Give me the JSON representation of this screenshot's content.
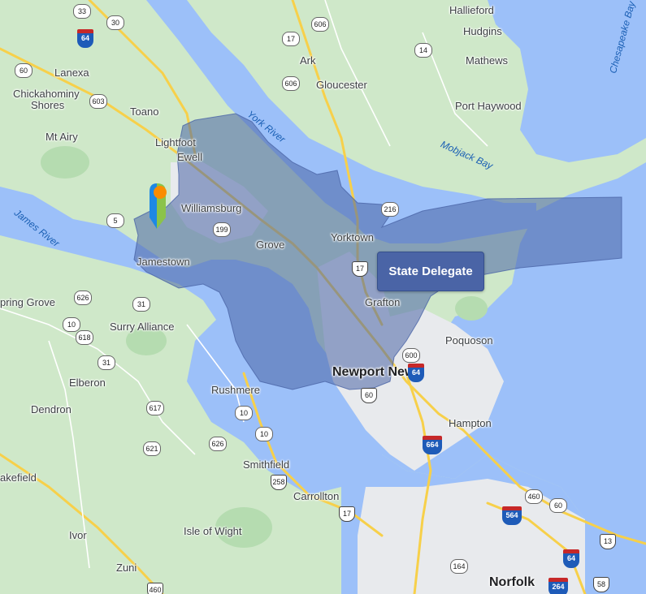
{
  "tooltip": {
    "label": "State Delegate"
  },
  "district_color": "#4a64a6",
  "pin_colors": [
    "#1e88e5",
    "#8bc34a",
    "#fb8c00"
  ],
  "water_labels": [
    {
      "name": "york-river",
      "text": "York River"
    },
    {
      "name": "james-river",
      "text": "James River"
    },
    {
      "name": "mobjack-bay",
      "text": "Mobjack Bay"
    },
    {
      "name": "chesapeake-bay",
      "text": "Chesapeake Bay"
    }
  ],
  "places": [
    {
      "name": "hallieford",
      "text": "Hallieford"
    },
    {
      "name": "hudgins",
      "text": "Hudgins"
    },
    {
      "name": "mathews",
      "text": "Mathews"
    },
    {
      "name": "ark",
      "text": "Ark"
    },
    {
      "name": "gloucester",
      "text": "Gloucester"
    },
    {
      "name": "port-haywood",
      "text": "Port Haywood"
    },
    {
      "name": "lanexa",
      "text": "Lanexa"
    },
    {
      "name": "chickahominy",
      "text": "Chickahominy"
    },
    {
      "name": "shores",
      "text": "Shores"
    },
    {
      "name": "toano",
      "text": "Toano"
    },
    {
      "name": "mt-airy",
      "text": "Mt Airy"
    },
    {
      "name": "lightfoot",
      "text": "Lightfoot"
    },
    {
      "name": "ewell",
      "text": "Ewell"
    },
    {
      "name": "williamsburg",
      "text": "Williamsburg"
    },
    {
      "name": "grove",
      "text": "Grove"
    },
    {
      "name": "yorktown",
      "text": "Yorktown"
    },
    {
      "name": "jamestown",
      "text": "Jamestown"
    },
    {
      "name": "spring-grove",
      "text": "pring Grove"
    },
    {
      "name": "surry-alliance",
      "text": "Surry Alliance"
    },
    {
      "name": "grafton",
      "text": "Grafton"
    },
    {
      "name": "poquoson",
      "text": "Poquoson"
    },
    {
      "name": "elberon",
      "text": "Elberon"
    },
    {
      "name": "newport-news",
      "text": "Newport News"
    },
    {
      "name": "dendron",
      "text": "Dendron"
    },
    {
      "name": "rushmere",
      "text": "Rushmere"
    },
    {
      "name": "hampton",
      "text": "Hampton"
    },
    {
      "name": "wakefield",
      "text": "akefield"
    },
    {
      "name": "smithfield",
      "text": "Smithfield"
    },
    {
      "name": "carrollton",
      "text": "Carrollton"
    },
    {
      "name": "ivor",
      "text": "Ivor"
    },
    {
      "name": "isle-of-wight",
      "text": "Isle of Wight"
    },
    {
      "name": "zuni",
      "text": "Zuni"
    },
    {
      "name": "norfolk",
      "text": "Norfolk"
    }
  ],
  "route_shields": [
    {
      "name": "route-33",
      "text": "33"
    },
    {
      "name": "route-30",
      "text": "30"
    },
    {
      "name": "route-606-n",
      "text": "606"
    },
    {
      "name": "route-17-n",
      "text": "17"
    },
    {
      "name": "route-14",
      "text": "14"
    },
    {
      "name": "route-606",
      "text": "606"
    },
    {
      "name": "route-60-w",
      "text": "60"
    },
    {
      "name": "route-603",
      "text": "603"
    },
    {
      "name": "route-5",
      "text": "5"
    },
    {
      "name": "route-216",
      "text": "216"
    },
    {
      "name": "route-199",
      "text": "199"
    },
    {
      "name": "route-626",
      "text": "626"
    },
    {
      "name": "route-31",
      "text": "31"
    },
    {
      "name": "route-10",
      "text": "10"
    },
    {
      "name": "route-618",
      "text": "618"
    },
    {
      "name": "route-31-s",
      "text": "31"
    },
    {
      "name": "route-600",
      "text": "600"
    },
    {
      "name": "route-60-s",
      "text": "60"
    },
    {
      "name": "route-617",
      "text": "617"
    },
    {
      "name": "route-10-s",
      "text": "10"
    },
    {
      "name": "route-10-e",
      "text": "10"
    },
    {
      "name": "route-621",
      "text": "621"
    },
    {
      "name": "route-626-s",
      "text": "626"
    },
    {
      "name": "route-258",
      "text": "258"
    },
    {
      "name": "route-17-s",
      "text": "17"
    },
    {
      "name": "route-460",
      "text": "460"
    },
    {
      "name": "route-60-e",
      "text": "60"
    },
    {
      "name": "route-13",
      "text": "13"
    },
    {
      "name": "route-164",
      "text": "164"
    },
    {
      "name": "route-58",
      "text": "58"
    },
    {
      "name": "route-460-s",
      "text": "460"
    }
  ],
  "us_shields": [
    {
      "name": "us-17-n",
      "text": "17"
    },
    {
      "name": "us-17-mid",
      "text": "17"
    },
    {
      "name": "us-60-w",
      "text": "60"
    },
    {
      "name": "us-60-nn",
      "text": "60"
    },
    {
      "name": "us-17-s",
      "text": "17"
    },
    {
      "name": "us-258",
      "text": "258"
    },
    {
      "name": "us-460-s",
      "text": "460"
    },
    {
      "name": "us-13",
      "text": "13"
    },
    {
      "name": "us-58",
      "text": "58"
    }
  ],
  "interstates": [
    {
      "name": "i-64-nw",
      "text": "64"
    },
    {
      "name": "i-64-nn",
      "text": "64"
    },
    {
      "name": "i-664",
      "text": "664"
    },
    {
      "name": "i-564",
      "text": "564"
    },
    {
      "name": "i-64-e",
      "text": "64"
    },
    {
      "name": "i-264",
      "text": "264"
    }
  ]
}
